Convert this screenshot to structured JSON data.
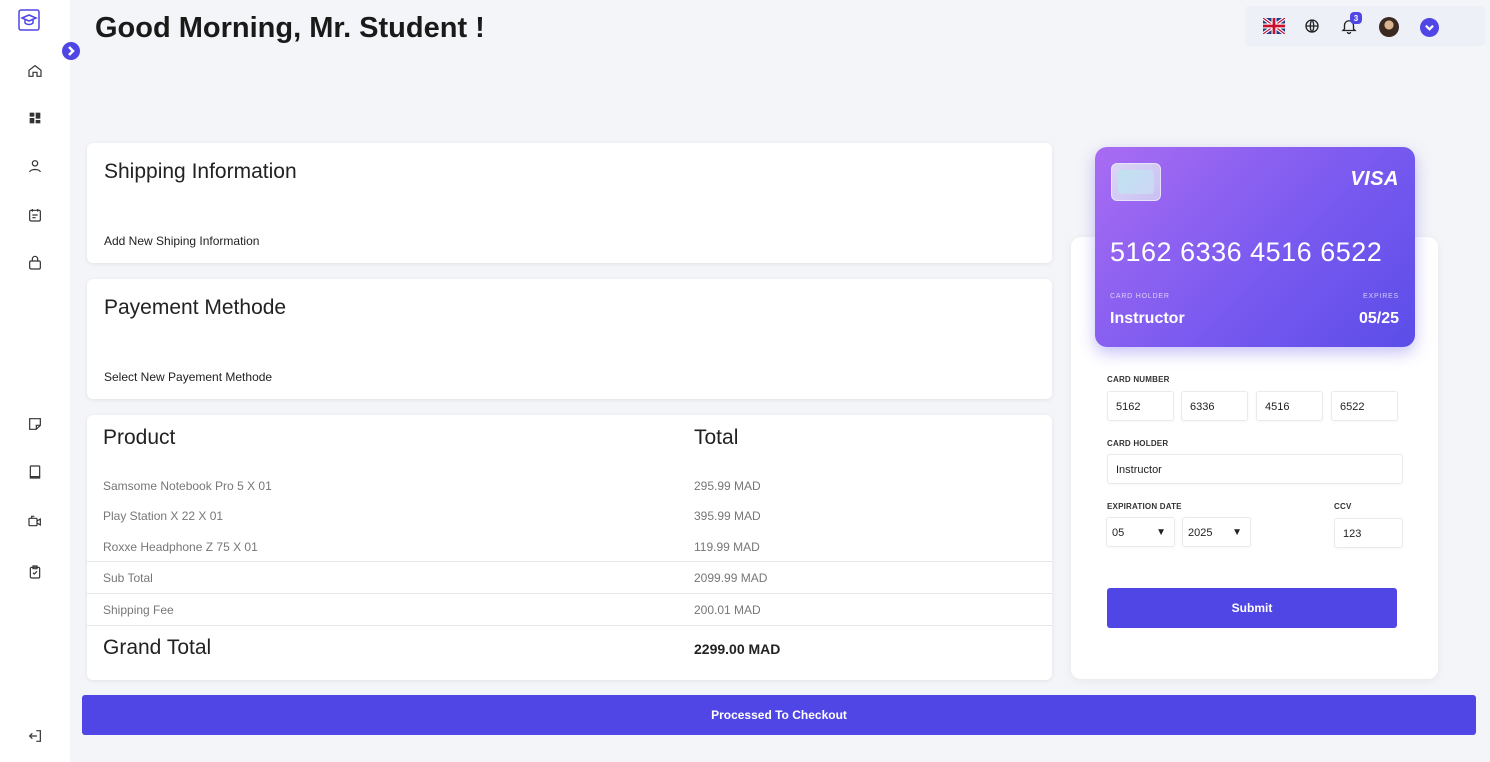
{
  "header": {
    "greeting": "Good Morning, Mr. Student !",
    "notification_count": "3"
  },
  "sidebar": {
    "icons": [
      "graduation-cap-icon",
      "home-icon",
      "dashboard-icon",
      "user-icon",
      "calendar-icon",
      "shopping-bag-icon",
      "note-icon",
      "book-icon",
      "video-icon",
      "clipboard-check-icon",
      "logout-icon"
    ]
  },
  "shipping": {
    "title": "Shipping Information",
    "subtitle": "Add New Shiping Information"
  },
  "payment": {
    "title": "Payement Methode",
    "subtitle": "Select New Payement Methode"
  },
  "order": {
    "product_header": "Product",
    "total_header": "Total",
    "items": [
      {
        "name": "Samsome Notebook Pro 5 X 01",
        "total": "295.99 MAD"
      },
      {
        "name": "Play Station X 22 X 01",
        "total": "395.99 MAD"
      },
      {
        "name": "Roxxe Headphone Z 75 X 01",
        "total": "119.99 MAD"
      }
    ],
    "subtotal_label": "Sub Total",
    "subtotal_value": "2099.99 MAD",
    "shipping_label": "Shipping Fee",
    "shipping_value": "200.01 MAD",
    "grand_label": "Grand Total",
    "grand_value": "2299.00 MAD"
  },
  "card": {
    "brand": "VISA",
    "number": "5162 6336 4516 6522",
    "holder_caption": "CARD HOLDER",
    "holder": "Instructor",
    "expires_caption": "EXPIRES",
    "expires": "05/25"
  },
  "form": {
    "card_number_label": "CARD NUMBER",
    "card_number_parts": [
      "5162",
      "6336",
      "4516",
      "6522"
    ],
    "card_holder_label": "CARD HOLDER",
    "card_holder_value": "Instructor",
    "expiration_label": "EXPIRATION DATE",
    "exp_month": "05",
    "exp_year": "2025",
    "ccv_label": "CCV",
    "ccv_value": "123",
    "select_arrow": "▼",
    "submit_label": "Submit"
  },
  "checkout": {
    "label": "Processed To Checkout"
  },
  "colors": {
    "accent": "#4f46e5",
    "background": "#f4f5f8"
  }
}
